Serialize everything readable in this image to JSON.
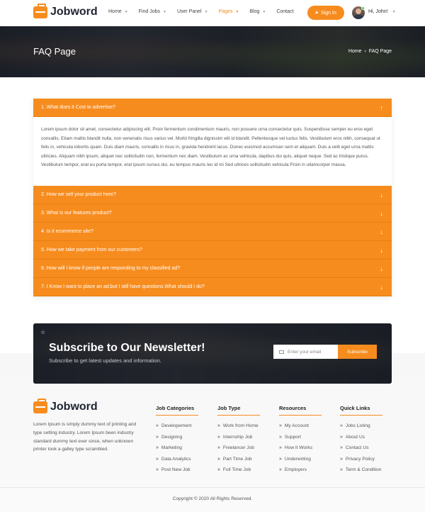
{
  "brand": "Jobword",
  "nav": [
    {
      "label": "Home",
      "has_caret": true,
      "active": false
    },
    {
      "label": "Find Jobs",
      "has_caret": true,
      "active": false
    },
    {
      "label": "User Panel",
      "has_caret": true,
      "active": false
    },
    {
      "label": "Pages",
      "has_caret": true,
      "active": true
    },
    {
      "label": "Blog",
      "has_caret": true,
      "active": false
    },
    {
      "label": "Contact",
      "has_caret": false,
      "active": false
    }
  ],
  "signin_label": "Sign In",
  "user_greeting": "Hi, John!",
  "banner": {
    "title": "FAQ Page",
    "breadcrumb_home": "Home",
    "breadcrumb_sep": "›",
    "breadcrumb_current": "FAQ Page"
  },
  "faq": {
    "open_index": 0,
    "items": [
      {
        "q": "1. What does it Cost to advertise?",
        "a": "Lorem ipsum dolor sit amet, consectetur adipiscing elit. Proin fermentum condimentum mauris, non posuere urna consectetur quis. Suspendisse semper eu eros eget convallis. Etiam mattis blandit nulla, non venenatis risus varius vel. Morbi fringilla dignissim elit id blandit. Pellentesque vel luctus felis. Vestibulum eros nibh, consequat ut felis in, vehicula lobortis quam. Duis diam mauris, convallis in risus in, gravida hendrerit lacus. Donec euismod accumsan sem et aliquam. Duis a velit eget urna mattis ultricies. Aliquam nibh ipsum, aliquet nec sollicitudin non, fermentum nec diam. Vestibulum ac urna vehicula, dapibus dui quis, aliquet neque. Sed ac tristique purus. Vestibulum tempor, erat eu porta tempor, erat ipsum cursus dui, eu tempus mauris leo id mi Sed ultrices sollicitudin vehicula Proin in ullamcorper massa."
      },
      {
        "q": "2. How we sell your product here?"
      },
      {
        "q": "3. What is our features product?"
      },
      {
        "q": "4. Is it ecommerce site?"
      },
      {
        "q": "5. How we take payment from our customers?"
      },
      {
        "q": "6. How will I know if people are responding to my classified ad?"
      },
      {
        "q": "7. I Know I want to place an ad,but I still have questions.What should I do?"
      }
    ]
  },
  "newsletter": {
    "title": "Subscribe to Our Newsletter!",
    "subtitle": "Subscribe to get latest updates and information.",
    "email_placeholder": "Enter your email",
    "button": "Subscribe"
  },
  "footer": {
    "about": "Lorem Ipsum is simply dummy text of printing and type setting industry. Lorem Ipsum been industry standard dummy text ever since, when unknown printer took a galley type scrambled.",
    "columns": [
      {
        "title": "Job Categories",
        "links": [
          "Developement",
          "Designing",
          "Marketing",
          "Data Analytics",
          "Post New Job"
        ]
      },
      {
        "title": "Job Type",
        "links": [
          "Work from Home",
          "Internship Job",
          "Freelancer Job",
          "Part Time Job",
          "Full Time Job"
        ]
      },
      {
        "title": "Resources",
        "links": [
          "My Account",
          "Support",
          "How It Works",
          "Underwriting",
          "Employers"
        ]
      },
      {
        "title": "Quick Links",
        "links": [
          "Jobs Listing",
          "About Us",
          "Contact Us",
          "Privacy Policy",
          "Term & Condition"
        ]
      }
    ],
    "copyright": "Copyright © 2020 All Rights Reserved."
  },
  "colors": {
    "accent": "#f78c1e",
    "dark": "#1f2430"
  }
}
